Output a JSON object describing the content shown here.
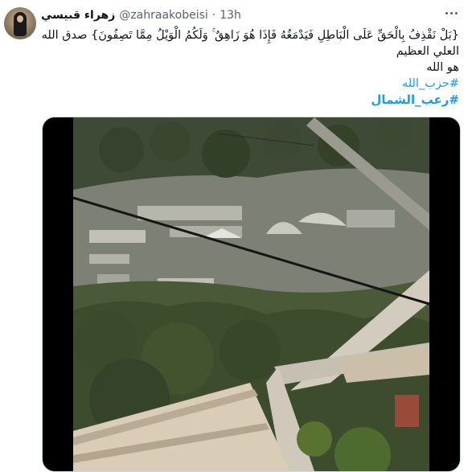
{
  "tweet": {
    "display_name": "زهراء قبيسي",
    "handle": "@zahraakobeisi",
    "separator": "·",
    "time": "13h",
    "text_line1": "{بَلْ نَقْذِفُ بِالْحَقِّ عَلَى الْبَاطِلِ فَيَدْمَغُهُ فَإِذَا هُوَ زَاهِقٌ ۚ وَلَكُمُ الْوَيْلُ مِمَّا تَصِفُونَ} صدق الله العلي العظيم",
    "text_line2": "هو الله",
    "hashtags": [
      "#حزب_الله",
      "#رعب_الشمال"
    ]
  },
  "icons": {
    "more": "more-horizontal-icon"
  },
  "colors": {
    "link": "#1d9bf0",
    "text": "#0f1419",
    "secondary": "#536471"
  }
}
